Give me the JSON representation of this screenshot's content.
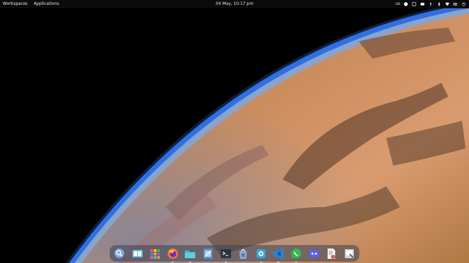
{
  "topbar": {
    "workspaces_label": "Workspaces",
    "applications_label": "Applications",
    "clock": "04 May, 10:17 pm",
    "keyboard_layout": "us",
    "tray_icons": [
      "status-circle-icon",
      "app-indicator-icon",
      "screen-record-icon",
      "usb-icon",
      "bluetooth-icon",
      "wifi-icon",
      "battery-icon",
      "power-icon"
    ]
  },
  "dock": {
    "apps": [
      {
        "name": "search-app",
        "color": "#7aa7e8",
        "running": false
      },
      {
        "name": "workspaces-app",
        "color": "#6fb7e6",
        "running": false
      },
      {
        "name": "app-grid",
        "color": "#f0a23a",
        "running": false
      },
      {
        "name": "firefox",
        "color": "#ff7139",
        "running": true
      },
      {
        "name": "files",
        "color": "#3fb6c8",
        "running": true
      },
      {
        "name": "text-editor",
        "color": "#5b8fc9",
        "running": false
      },
      {
        "name": "terminal",
        "color": "#2b3442",
        "running": true
      },
      {
        "name": "store",
        "color": "#8fa7d6",
        "running": false
      },
      {
        "name": "bottles",
        "color": "#37a8d8",
        "running": true
      },
      {
        "name": "vscode",
        "color": "#1e88e5",
        "running": true
      },
      {
        "name": "whatsapp",
        "color": "#2fbf4a",
        "running": true
      },
      {
        "name": "discord",
        "color": "#5865f2",
        "running": false
      },
      {
        "name": "document-viewer",
        "color": "#e05a4f",
        "running": false
      },
      {
        "name": "screenshot-tool",
        "color": "#cfd4dc",
        "running": false
      }
    ]
  },
  "colors": {
    "topbar": "#0b0b0b",
    "dock": "#3c4250",
    "space": "#000000",
    "atmosphere": "#2f6fe6",
    "desert": "#c98a5a"
  }
}
